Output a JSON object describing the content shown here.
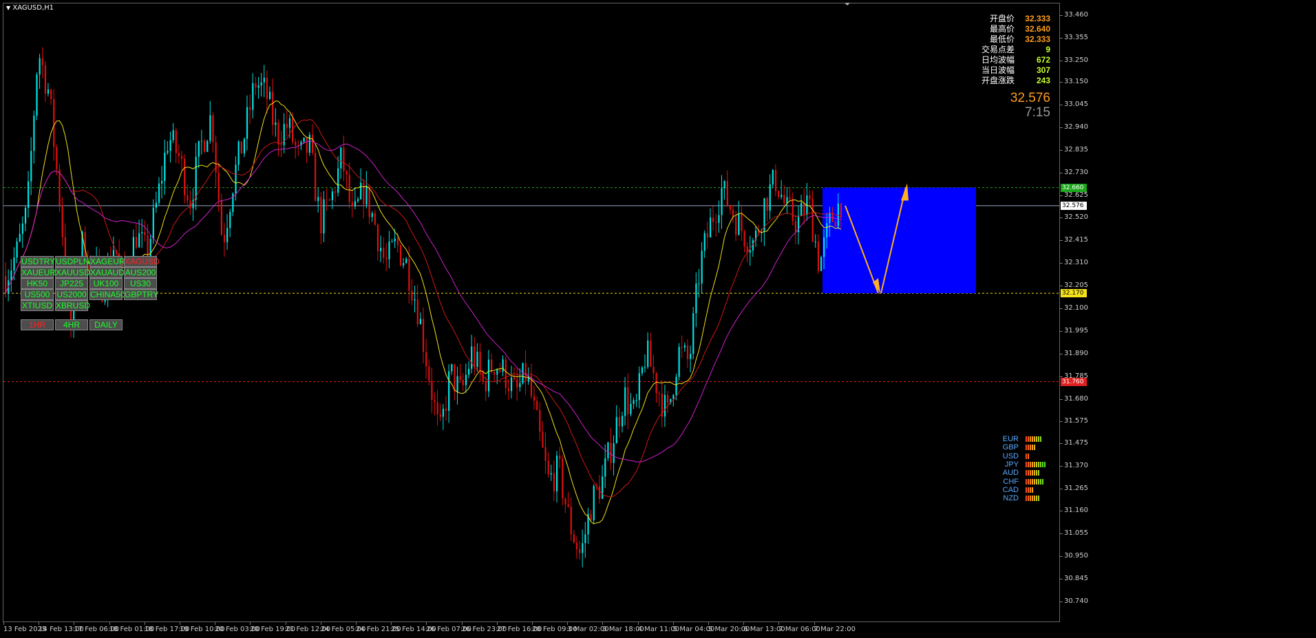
{
  "window": {
    "symbol_title": "XAGUSD,H1"
  },
  "info_panel": {
    "rows": [
      {
        "label": "开盘价",
        "value": "32.333",
        "color": "#ff9e1b"
      },
      {
        "label": "最高价",
        "value": "32.640",
        "color": "#ff9e1b"
      },
      {
        "label": "最低价",
        "value": "32.333",
        "color": "#ff9e1b"
      },
      {
        "label": "交易点差",
        "value": "9",
        "color": "#c8ff2d"
      },
      {
        "label": "日均波幅",
        "value": "672",
        "color": "#c8ff2d"
      },
      {
        "label": "当日波幅",
        "value": "307",
        "color": "#c8ff2d"
      },
      {
        "label": "开盘涨跌",
        "value": "243",
        "color": "#c8ff2d"
      }
    ],
    "current_price": "32.576",
    "countdown": "7:15"
  },
  "symbol_buttons": [
    {
      "label": "USDTRY"
    },
    {
      "label": "USDPLN"
    },
    {
      "label": "XAGEUR"
    },
    {
      "label": "XAGUSD",
      "active": true
    },
    {
      "label": "XAUEUR"
    },
    {
      "label": "XAUUSD"
    },
    {
      "label": "XAUAUD"
    },
    {
      "label": "AUS200"
    },
    {
      "label": "HK50"
    },
    {
      "label": "JP225"
    },
    {
      "label": "UK100"
    },
    {
      "label": "US30"
    },
    {
      "label": "US500"
    },
    {
      "label": "US2000"
    },
    {
      "label": "CHINA50"
    },
    {
      "label": "GBPTRY"
    },
    {
      "label": "XTIUSD"
    },
    {
      "label": "XBRUSD"
    }
  ],
  "timeframe_buttons": [
    {
      "label": "1HR",
      "active": true
    },
    {
      "label": "4HR"
    },
    {
      "label": "DAILY"
    }
  ],
  "price_axis": {
    "min": 30.74,
    "max": 33.46,
    "ticks": [
      "33.460",
      "33.355",
      "33.250",
      "33.150",
      "33.045",
      "32.940",
      "32.835",
      "32.730",
      "32.625",
      "32.520",
      "32.415",
      "32.310",
      "32.205",
      "32.100",
      "31.995",
      "31.890",
      "31.785",
      "31.680",
      "31.575",
      "31.475",
      "31.370",
      "31.265",
      "31.160",
      "31.055",
      "30.950",
      "30.845",
      "30.740"
    ],
    "badges": [
      {
        "value": "32.660",
        "color": "#1aa81a",
        "text_color": "#ffffff"
      },
      {
        "value": "32.576",
        "color": "#ffffff",
        "text_color": "#000000"
      },
      {
        "value": "32.170",
        "color": "#f5e21b",
        "text_color": "#000000"
      },
      {
        "value": "31.760",
        "color": "#e02020",
        "text_color": "#ffffff"
      }
    ]
  },
  "time_axis": {
    "ticks": [
      "13 Feb 2025",
      "14 Feb 13:00",
      "17 Feb 06:00",
      "18 Feb 01:00",
      "18 Feb 17:00",
      "19 Feb 10:00",
      "20 Feb 03:00",
      "20 Feb 19:00",
      "21 Feb 12:00",
      "24 Feb 05:00",
      "24 Feb 21:00",
      "25 Feb 14:00",
      "26 Feb 07:00",
      "26 Feb 23:00",
      "27 Feb 16:00",
      "28 Feb 09:00",
      "3 Mar 02:00",
      "3 Mar 18:00",
      "4 Mar 11:00",
      "5 Mar 04:00",
      "5 Mar 20:00",
      "6 Mar 13:00",
      "7 Mar 06:00",
      "7 Mar 22:00"
    ]
  },
  "levels": [
    {
      "price": 32.66,
      "color": "#1aa81a",
      "style": "dashed"
    },
    {
      "price": 32.576,
      "color": "#9aa8c8",
      "style": "solid"
    },
    {
      "price": 32.17,
      "color": "#f5e21b",
      "style": "dashed"
    },
    {
      "price": 31.76,
      "color": "#e02020",
      "style": "dashed"
    }
  ],
  "colors": {
    "bull": "#00e5e5",
    "bear": "#e01010",
    "ma_fast": "#f5e21b",
    "ma_mid": "#d01818",
    "ma_slow": "#d020d0",
    "zone": "#0000ff",
    "arrow": "#ffb020"
  },
  "chart_data": {
    "type": "candlestick",
    "x_ticks": [
      "13 Feb 2025",
      "14 Feb 13:00",
      "17 Feb 06:00",
      "18 Feb 01:00",
      "18 Feb 17:00",
      "19 Feb 10:00",
      "20 Feb 03:00",
      "20 Feb 19:00",
      "21 Feb 12:00",
      "24 Feb 05:00",
      "24 Feb 21:00",
      "25 Feb 14:00",
      "26 Feb 07:00",
      "26 Feb 23:00",
      "27 Feb 16:00",
      "28 Feb 09:00",
      "3 Mar 02:00",
      "3 Mar 18:00",
      "4 Mar 11:00",
      "5 Mar 04:00",
      "5 Mar 20:00",
      "6 Mar 13:00",
      "7 Mar 06:00",
      "7 Mar 22:00"
    ],
    "ylim": [
      30.74,
      33.46
    ],
    "price_path": [
      32.25,
      32.35,
      32.55,
      33.3,
      33.1,
      32.6,
      32.0,
      32.4,
      32.3,
      32.2,
      32.4,
      32.2,
      32.45,
      32.35,
      32.6,
      32.9,
      32.8,
      32.6,
      32.85,
      33.0,
      32.4,
      32.7,
      32.9,
      33.15,
      33.1,
      32.9,
      32.95,
      32.8,
      32.85,
      32.5,
      32.6,
      32.8,
      32.5,
      32.65,
      32.5,
      32.3,
      32.4,
      32.3,
      32.1,
      31.8,
      31.5,
      31.8,
      31.7,
      31.9,
      31.75,
      31.85,
      31.8,
      31.7,
      31.8,
      31.55,
      31.3,
      31.35,
      31.1,
      30.95,
      31.2,
      31.3,
      31.5,
      31.7,
      31.6,
      31.9,
      31.75,
      31.6,
      31.9,
      31.85,
      32.3,
      32.5,
      32.65,
      32.55,
      32.45,
      32.4,
      32.6,
      32.7,
      32.55,
      32.5,
      32.6,
      32.3,
      32.5,
      32.6
    ]
  },
  "trade_zone": {
    "top": 32.66,
    "bottom": 32.17
  },
  "strength_panel": [
    {
      "label": "EUR",
      "bars": 8
    },
    {
      "label": "GBP",
      "bars": 5
    },
    {
      "label": "USD",
      "bars": 2
    },
    {
      "label": "JPY",
      "bars": 10
    },
    {
      "label": "AUD",
      "bars": 7
    },
    {
      "label": "CHF",
      "bars": 9
    },
    {
      "label": "CAD",
      "bars": 4
    },
    {
      "label": "NZD",
      "bars": 7
    }
  ]
}
